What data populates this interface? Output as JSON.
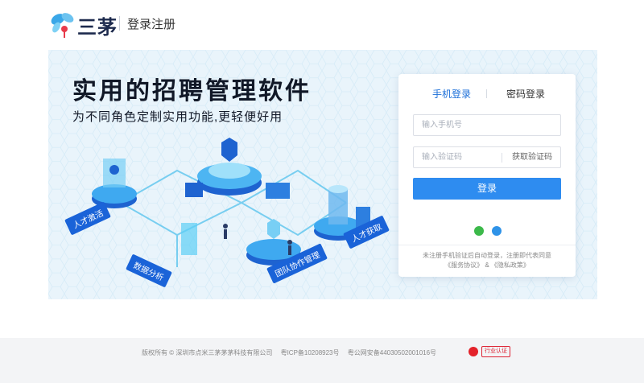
{
  "header": {
    "logo_text": "三茅",
    "subtitle": "登录注册"
  },
  "banner": {
    "headline": "实用的招聘管理软件",
    "subline": "为不同角色定制实用功能,更轻便好用",
    "tags": [
      "人才激活",
      "数据分析",
      "团队协作管理",
      "人才获取"
    ]
  },
  "login": {
    "tabs": [
      {
        "label": "手机登录",
        "active": true
      },
      {
        "label": "密码登录",
        "active": false
      }
    ],
    "phone_placeholder": "输入手机号",
    "code_placeholder": "输入验证码",
    "get_code_label": "获取验证码",
    "submit_label": "登录",
    "social_icons": [
      "wechat-icon",
      "qq-icon"
    ],
    "terms_line1": "未注册手机验证后自动登录，注册即代表同意",
    "terms_service": "《服务协议》",
    "terms_and": "&",
    "terms_privacy": "《隐私政策》"
  },
  "footer": {
    "copyright": "版权所有 © 深圳市点米三茅茅茅科技有限公司",
    "icp": "粤ICP备10208923号",
    "police": "粤公网安备44030502001016号",
    "cert_label": "行业认证"
  },
  "colors": {
    "accent": "#2e8cf0",
    "tab_active": "#1a6ed8",
    "banner_bg": "#e9f4fb",
    "tag_bg": "#1a63d8"
  }
}
